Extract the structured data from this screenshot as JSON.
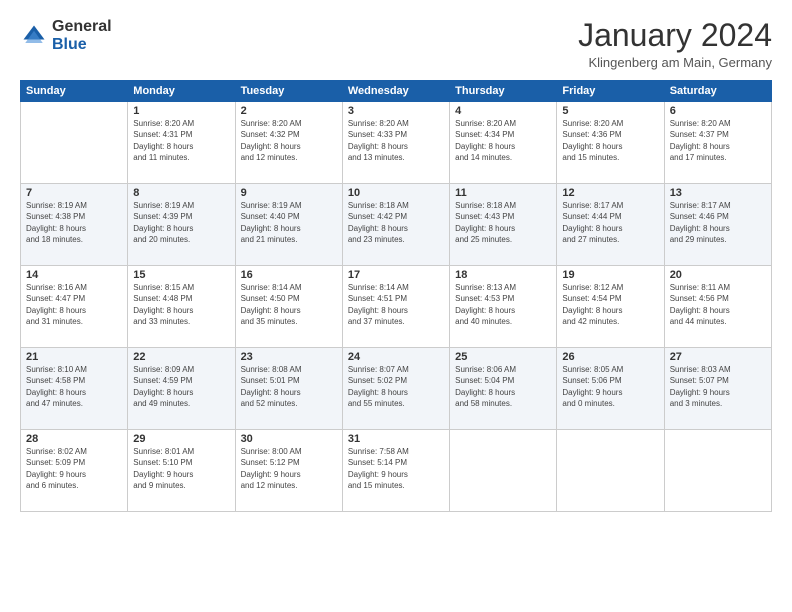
{
  "header": {
    "logo_general": "General",
    "logo_blue": "Blue",
    "title": "January 2024",
    "subtitle": "Klingenberg am Main, Germany"
  },
  "columns": [
    "Sunday",
    "Monday",
    "Tuesday",
    "Wednesday",
    "Thursday",
    "Friday",
    "Saturday"
  ],
  "weeks": [
    [
      {
        "day": "",
        "info": ""
      },
      {
        "day": "1",
        "info": "Sunrise: 8:20 AM\nSunset: 4:31 PM\nDaylight: 8 hours\nand 11 minutes."
      },
      {
        "day": "2",
        "info": "Sunrise: 8:20 AM\nSunset: 4:32 PM\nDaylight: 8 hours\nand 12 minutes."
      },
      {
        "day": "3",
        "info": "Sunrise: 8:20 AM\nSunset: 4:33 PM\nDaylight: 8 hours\nand 13 minutes."
      },
      {
        "day": "4",
        "info": "Sunrise: 8:20 AM\nSunset: 4:34 PM\nDaylight: 8 hours\nand 14 minutes."
      },
      {
        "day": "5",
        "info": "Sunrise: 8:20 AM\nSunset: 4:36 PM\nDaylight: 8 hours\nand 15 minutes."
      },
      {
        "day": "6",
        "info": "Sunrise: 8:20 AM\nSunset: 4:37 PM\nDaylight: 8 hours\nand 17 minutes."
      }
    ],
    [
      {
        "day": "7",
        "info": "Sunrise: 8:19 AM\nSunset: 4:38 PM\nDaylight: 8 hours\nand 18 minutes."
      },
      {
        "day": "8",
        "info": "Sunrise: 8:19 AM\nSunset: 4:39 PM\nDaylight: 8 hours\nand 20 minutes."
      },
      {
        "day": "9",
        "info": "Sunrise: 8:19 AM\nSunset: 4:40 PM\nDaylight: 8 hours\nand 21 minutes."
      },
      {
        "day": "10",
        "info": "Sunrise: 8:18 AM\nSunset: 4:42 PM\nDaylight: 8 hours\nand 23 minutes."
      },
      {
        "day": "11",
        "info": "Sunrise: 8:18 AM\nSunset: 4:43 PM\nDaylight: 8 hours\nand 25 minutes."
      },
      {
        "day": "12",
        "info": "Sunrise: 8:17 AM\nSunset: 4:44 PM\nDaylight: 8 hours\nand 27 minutes."
      },
      {
        "day": "13",
        "info": "Sunrise: 8:17 AM\nSunset: 4:46 PM\nDaylight: 8 hours\nand 29 minutes."
      }
    ],
    [
      {
        "day": "14",
        "info": "Sunrise: 8:16 AM\nSunset: 4:47 PM\nDaylight: 8 hours\nand 31 minutes."
      },
      {
        "day": "15",
        "info": "Sunrise: 8:15 AM\nSunset: 4:48 PM\nDaylight: 8 hours\nand 33 minutes."
      },
      {
        "day": "16",
        "info": "Sunrise: 8:14 AM\nSunset: 4:50 PM\nDaylight: 8 hours\nand 35 minutes."
      },
      {
        "day": "17",
        "info": "Sunrise: 8:14 AM\nSunset: 4:51 PM\nDaylight: 8 hours\nand 37 minutes."
      },
      {
        "day": "18",
        "info": "Sunrise: 8:13 AM\nSunset: 4:53 PM\nDaylight: 8 hours\nand 40 minutes."
      },
      {
        "day": "19",
        "info": "Sunrise: 8:12 AM\nSunset: 4:54 PM\nDaylight: 8 hours\nand 42 minutes."
      },
      {
        "day": "20",
        "info": "Sunrise: 8:11 AM\nSunset: 4:56 PM\nDaylight: 8 hours\nand 44 minutes."
      }
    ],
    [
      {
        "day": "21",
        "info": "Sunrise: 8:10 AM\nSunset: 4:58 PM\nDaylight: 8 hours\nand 47 minutes."
      },
      {
        "day": "22",
        "info": "Sunrise: 8:09 AM\nSunset: 4:59 PM\nDaylight: 8 hours\nand 49 minutes."
      },
      {
        "day": "23",
        "info": "Sunrise: 8:08 AM\nSunset: 5:01 PM\nDaylight: 8 hours\nand 52 minutes."
      },
      {
        "day": "24",
        "info": "Sunrise: 8:07 AM\nSunset: 5:02 PM\nDaylight: 8 hours\nand 55 minutes."
      },
      {
        "day": "25",
        "info": "Sunrise: 8:06 AM\nSunset: 5:04 PM\nDaylight: 8 hours\nand 58 minutes."
      },
      {
        "day": "26",
        "info": "Sunrise: 8:05 AM\nSunset: 5:06 PM\nDaylight: 9 hours\nand 0 minutes."
      },
      {
        "day": "27",
        "info": "Sunrise: 8:03 AM\nSunset: 5:07 PM\nDaylight: 9 hours\nand 3 minutes."
      }
    ],
    [
      {
        "day": "28",
        "info": "Sunrise: 8:02 AM\nSunset: 5:09 PM\nDaylight: 9 hours\nand 6 minutes."
      },
      {
        "day": "29",
        "info": "Sunrise: 8:01 AM\nSunset: 5:10 PM\nDaylight: 9 hours\nand 9 minutes."
      },
      {
        "day": "30",
        "info": "Sunrise: 8:00 AM\nSunset: 5:12 PM\nDaylight: 9 hours\nand 12 minutes."
      },
      {
        "day": "31",
        "info": "Sunrise: 7:58 AM\nSunset: 5:14 PM\nDaylight: 9 hours\nand 15 minutes."
      },
      {
        "day": "",
        "info": ""
      },
      {
        "day": "",
        "info": ""
      },
      {
        "day": "",
        "info": ""
      }
    ]
  ]
}
